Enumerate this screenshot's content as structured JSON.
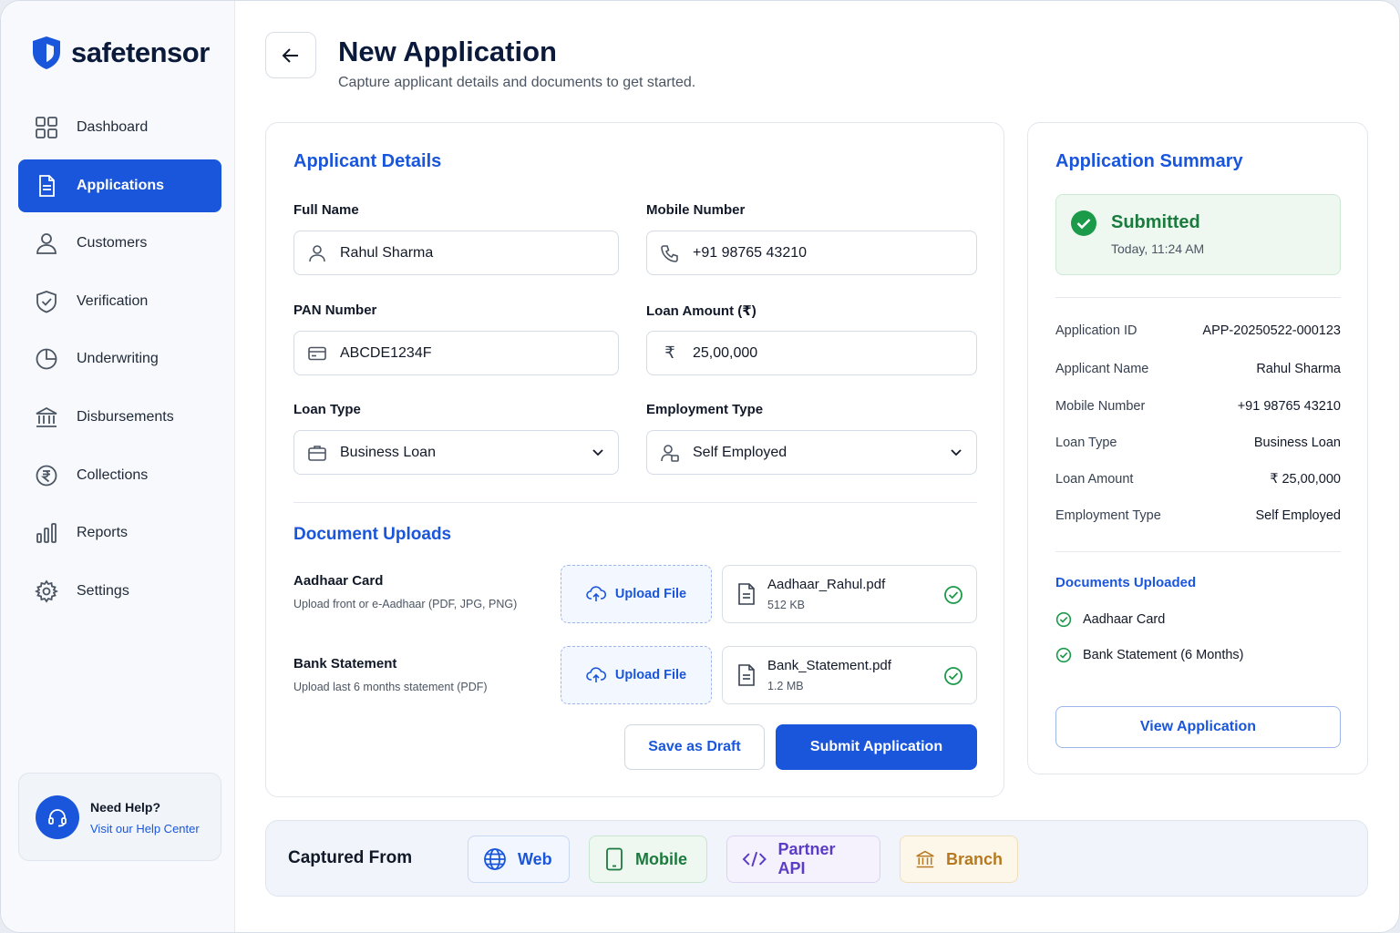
{
  "brand": {
    "name": "safetensor"
  },
  "sidebar": {
    "items": [
      {
        "label": "Dashboard",
        "icon": "grid-icon",
        "active": false
      },
      {
        "label": "Applications",
        "icon": "document-icon",
        "active": true
      },
      {
        "label": "Customers",
        "icon": "user-icon",
        "active": false
      },
      {
        "label": "Verification",
        "icon": "shield-check-icon",
        "active": false
      },
      {
        "label": "Underwriting",
        "icon": "pie-chart-icon",
        "active": false
      },
      {
        "label": "Disbursements",
        "icon": "bank-icon",
        "active": false
      },
      {
        "label": "Collections",
        "icon": "rupee-circle-icon",
        "active": false
      },
      {
        "label": "Reports",
        "icon": "bar-chart-icon",
        "active": false
      },
      {
        "label": "Settings",
        "icon": "gear-icon",
        "active": false
      }
    ],
    "help": {
      "title": "Need Help?",
      "link": "Visit our Help Center"
    }
  },
  "header": {
    "title": "New Application",
    "subtitle": "Capture applicant details and documents to get started."
  },
  "applicant": {
    "section_title": "Applicant Details",
    "full_name": {
      "label": "Full Name",
      "value": "Rahul Sharma"
    },
    "mobile": {
      "label": "Mobile Number",
      "value": "+91 98765 43210"
    },
    "pan": {
      "label": "PAN Number",
      "value": "ABCDE1234F"
    },
    "loan_amount": {
      "label": "Loan Amount (₹)",
      "value": "25,00,000",
      "prefix": "₹"
    },
    "loan_type": {
      "label": "Loan Type",
      "value": "Business Loan"
    },
    "employment_type": {
      "label": "Employment Type",
      "value": "Self Employed"
    }
  },
  "documents": {
    "section_title": "Document Uploads",
    "upload_label": "Upload File",
    "items": [
      {
        "title": "Aadhaar Card",
        "hint": "Upload front or e-Aadhaar (PDF, JPG, PNG)",
        "file_name": "Aadhaar_Rahul.pdf",
        "file_size": "512 KB"
      },
      {
        "title": "Bank Statement",
        "hint": "Upload last 6 months statement (PDF)",
        "file_name": "Bank_Statement.pdf",
        "file_size": "1.2 MB"
      }
    ]
  },
  "actions": {
    "save_draft": "Save as Draft",
    "submit": "Submit Application"
  },
  "summary": {
    "title": "Application Summary",
    "status": "Submitted",
    "status_time": "Today, 11:24 AM",
    "rows": [
      {
        "key": "Application ID",
        "value": "APP-20250522-000123"
      },
      {
        "key": "Applicant Name",
        "value": "Rahul Sharma"
      },
      {
        "key": "Mobile Number",
        "value": "+91 98765 43210"
      },
      {
        "key": "Loan Type",
        "value": "Business Loan"
      },
      {
        "key": "Loan Amount",
        "value": "₹ 25,00,000"
      },
      {
        "key": "Employment Type",
        "value": "Self Employed"
      }
    ],
    "documents_title": "Documents Uploaded",
    "documents": [
      "Aadhaar Card",
      "Bank Statement (6 Months)"
    ],
    "view_button": "View Application"
  },
  "captured": {
    "label": "Captured From",
    "channels": [
      {
        "label": "Web",
        "icon": "globe-icon",
        "color": "#1a56db"
      },
      {
        "label": "Mobile",
        "icon": "mobile-icon",
        "color": "#1b7a3d"
      },
      {
        "label": "Partner API",
        "icon": "code-icon",
        "color": "#5b3cc4"
      },
      {
        "label": "Branch",
        "icon": "bank-icon",
        "color": "#b7791f"
      }
    ]
  },
  "colors": {
    "accent": "#1a56db",
    "success": "#1b9a4a",
    "text": "#111827"
  }
}
